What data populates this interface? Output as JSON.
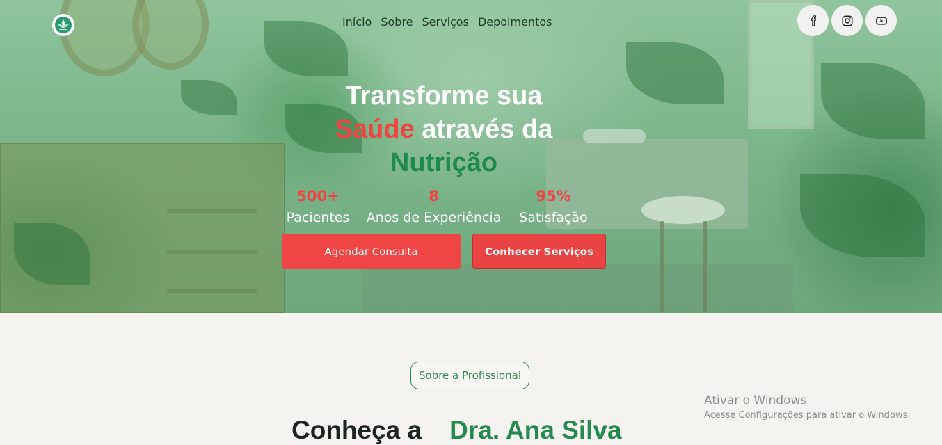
{
  "nav": {
    "items": [
      "Início",
      "Sobre",
      "Serviços",
      "Depoimentos"
    ]
  },
  "socials": {
    "icons": [
      "facebook-icon",
      "instagram-icon",
      "youtube-icon"
    ]
  },
  "hero": {
    "line1": "Transforme sua",
    "highlight_red": "Saúde",
    "line2_rest": " através da",
    "highlight_green": "Nutrição",
    "stats": [
      {
        "value": "500+",
        "label": "Pacientes"
      },
      {
        "value": "8",
        "label": "Anos de Experiência"
      },
      {
        "value": "95%",
        "label": "Satisfação"
      }
    ],
    "cta_primary": "Agendar Consulta",
    "cta_secondary": "Conhecer Serviços"
  },
  "about": {
    "badge": "Sobre a Profissional",
    "title_prefix": "Conheça a",
    "title_name": "Dra. Ana Silva"
  },
  "windows_watermark": {
    "title": "Ativar o Windows",
    "subtitle": "Acesse Configurações para ativar o Windows."
  },
  "colors": {
    "accent_red": "#ef4545",
    "accent_green": "#248a4d",
    "hero_overlay": "#7cb58a",
    "page_background": "#f4f3ef"
  }
}
